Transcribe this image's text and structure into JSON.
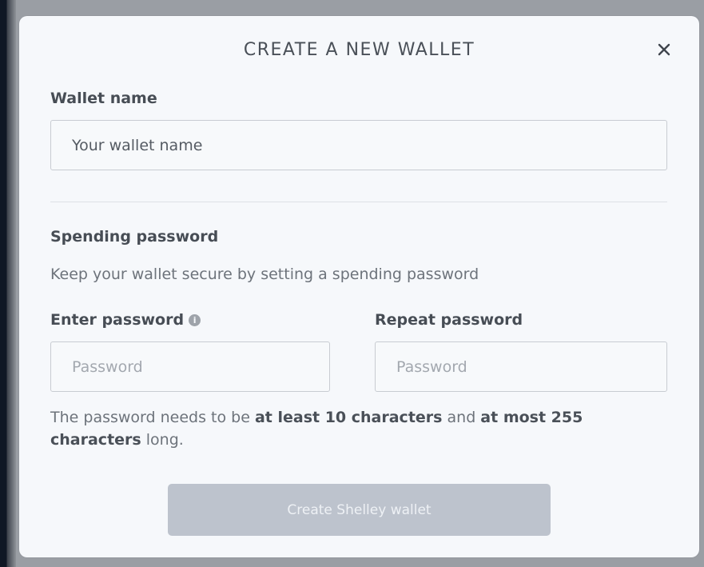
{
  "dialog": {
    "title": "CREATE A NEW WALLET"
  },
  "wallet_name": {
    "label": "Wallet name",
    "placeholder": "Your wallet name",
    "value": ""
  },
  "spending_password": {
    "heading": "Spending password",
    "description": "Keep your wallet secure by setting a spending password",
    "enter_label": "Enter password",
    "enter_placeholder": "Password",
    "repeat_label": "Repeat password",
    "repeat_placeholder": "Password",
    "hint_prefix": "The password needs to be ",
    "hint_min": "at least 10 characters",
    "hint_middle": " and ",
    "hint_max": "at most 255 characters",
    "hint_suffix": " long."
  },
  "submit": {
    "label": "Create Shelley wallet",
    "disabled": true
  },
  "icons": {
    "close": "close-icon",
    "info": "info-icon"
  },
  "colors": {
    "modal_background": "#f6f8fb",
    "button_disabled": "#bdc3cd",
    "text": "#4b515a"
  }
}
